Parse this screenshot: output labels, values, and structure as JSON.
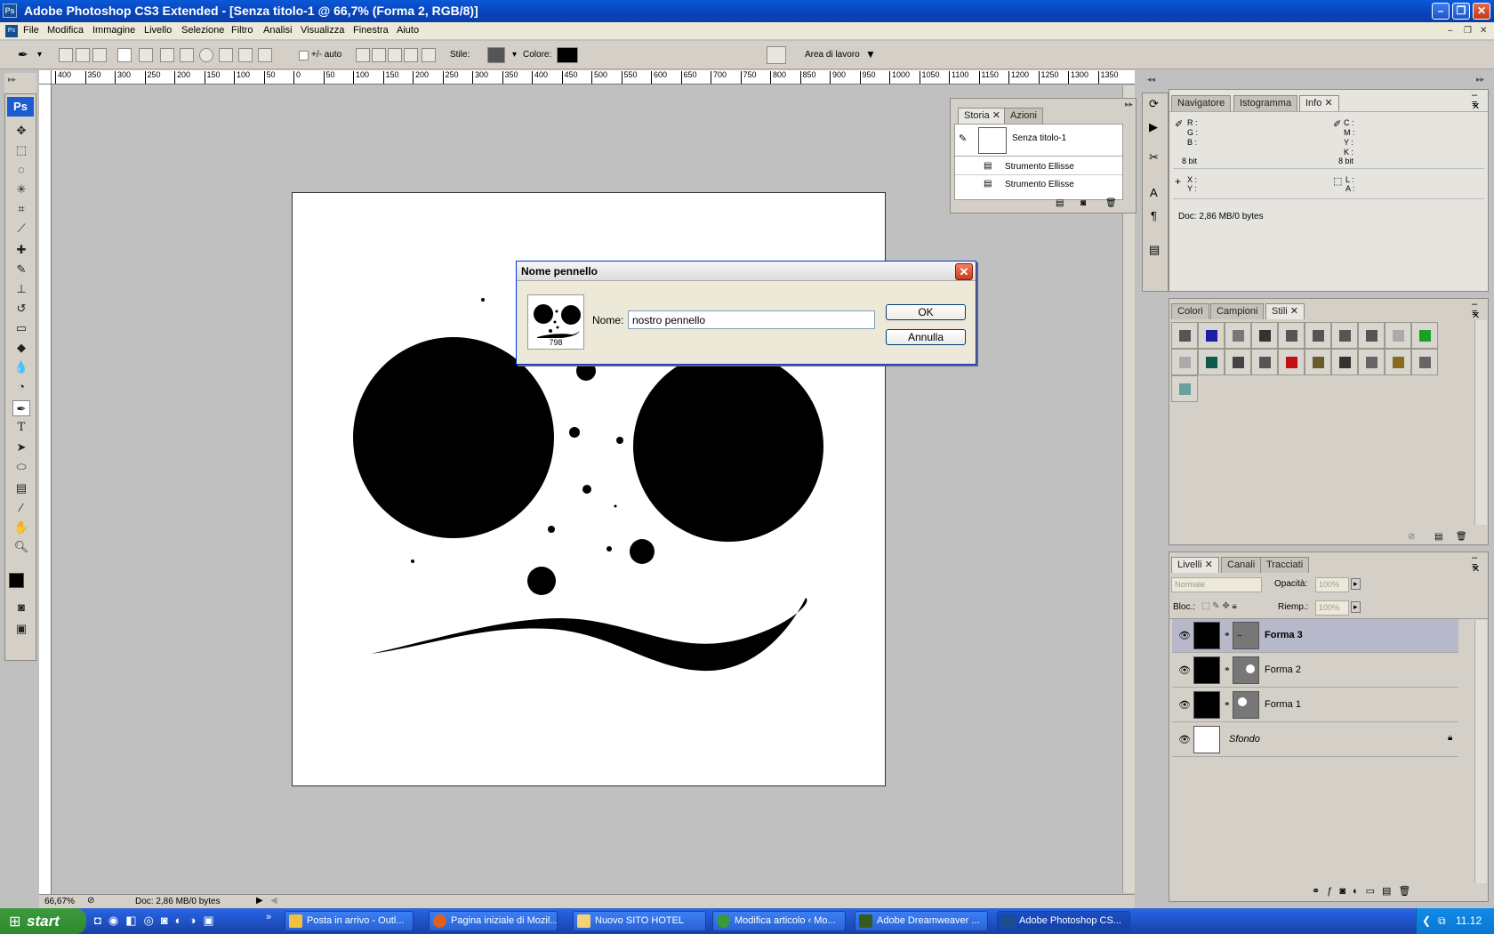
{
  "window": {
    "title": "Adobe Photoshop CS3 Extended - [Senza titolo-1 @ 66,7% (Forma 2, RGB/8)]",
    "app_badge": "Ps"
  },
  "menu": [
    "File",
    "Modifica",
    "Immagine",
    "Livello",
    "Selezione",
    "Filtro",
    "Analisi",
    "Visualizza",
    "Finestra",
    "Aiuto"
  ],
  "options": {
    "auto_label": "+/- auto",
    "stile_label": "Stile:",
    "colore_label": "Colore:",
    "workspace_label": "Area di lavoro"
  },
  "ruler_top": [
    "400",
    "350",
    "300",
    "250",
    "200",
    "150",
    "100",
    "50",
    "0",
    "50",
    "100",
    "150",
    "200",
    "250",
    "300",
    "350",
    "400",
    "450",
    "500",
    "550",
    "600",
    "650",
    "700",
    "750",
    "800",
    "850",
    "900",
    "950",
    "1000",
    "1050",
    "1100",
    "1150",
    "1200",
    "1250",
    "1300",
    "1350"
  ],
  "dialog": {
    "title": "Nome pennello",
    "brush_size": "798",
    "name_label": "Nome:",
    "name_value": "nostro pennello",
    "ok": "OK",
    "cancel": "Annulla"
  },
  "history": {
    "tabs": [
      "Storia",
      "Azioni"
    ],
    "snapshot": "Senza titolo-1",
    "steps": [
      "Strumento Ellisse",
      "Strumento Ellisse"
    ]
  },
  "info": {
    "tabs": [
      "Navigatore",
      "Istogramma",
      "Info"
    ],
    "r": "R :",
    "g": "G :",
    "b": "B :",
    "c": "C :",
    "m": "M :",
    "y": "Y :",
    "k": "K :",
    "bits_left": "8 bit",
    "bits_right": "8 bit",
    "x": "X :",
    "yy": "Y :",
    "w": "L :",
    "h": "A :",
    "doc": "Doc: 2,86 MB/0 bytes"
  },
  "styles": {
    "tabs": [
      "Colori",
      "Campioni",
      "Stili"
    ],
    "swatch_colors": [
      "#555555",
      "#1b1fa0",
      "#777777",
      "#333333",
      "#555555",
      "#555555",
      "#555555",
      "#555555",
      "#aaaaaa",
      "#1aa024",
      "#aaaaaa",
      "#0f5a4a",
      "#444444",
      "#555555",
      "#c01010",
      "#6b5a30",
      "#333333",
      "#666666",
      "#8a6a20",
      "#666666",
      "#6aa0a0"
    ]
  },
  "layers": {
    "tabs": [
      "Livelli",
      "Canali",
      "Tracciati"
    ],
    "blend": "Normale",
    "opacity_label": "Opacità:",
    "opacity_value": "100%",
    "lock_label": "Bloc.:",
    "fill_label": "Riemp.:",
    "fill_value": "100%",
    "items": [
      {
        "name": "Forma 3",
        "selected": true
      },
      {
        "name": "Forma 2",
        "selected": false
      },
      {
        "name": "Forma 1",
        "selected": false
      },
      {
        "name": "Sfondo",
        "selected": false
      }
    ]
  },
  "status": {
    "zoom": "66,67%",
    "doc": "Doc: 2,86 MB/0 bytes"
  },
  "taskbar": {
    "start": "start",
    "items": [
      "Posta in arrivo - Outl...",
      "Pagina iniziale di Mozil...",
      "Nuovo SITO HOTEL",
      "Modifica articolo ‹ Mo...",
      "Adobe Dreamweaver ...",
      "Adobe Photoshop CS..."
    ],
    "clock": "11.12"
  }
}
